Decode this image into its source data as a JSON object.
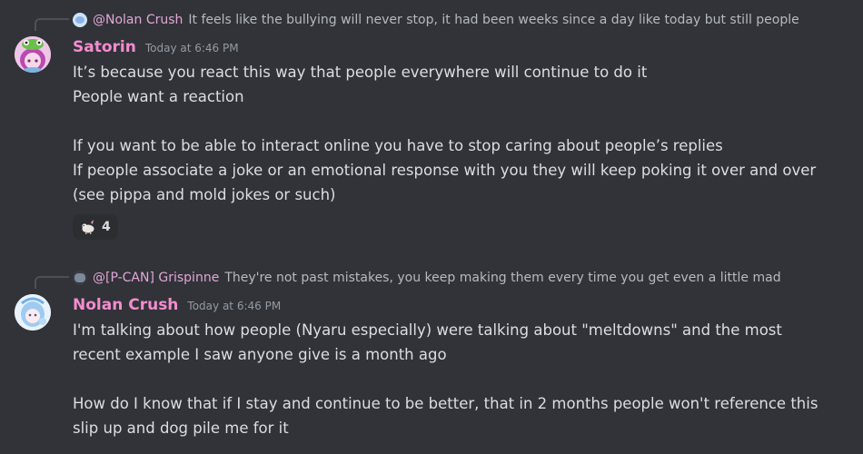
{
  "messages": [
    {
      "reply": {
        "author": "@Nolan Crush",
        "author_color": "#e2a7d6",
        "text": "It feels like the bullying will never stop, it had been weeks since a day like today but still people"
      },
      "author": "Satorin",
      "author_color": "#f48ccf",
      "timestamp": "Today at 6:46 PM",
      "lines": [
        "It’s because you react this way that people everywhere will continue to do it",
        "People want a reaction",
        "",
        "If you want to be able to interact online you have to stop caring about people’s replies",
        "If people associate a joke or an emotional response with you they will keep poking it over and over",
        "(see pippa and mold jokes or such)"
      ],
      "reaction": {
        "emoji": "sheep-emoji",
        "count": "4"
      }
    },
    {
      "reply": {
        "author": "@[P-CAN] Grispinne",
        "author_color": "#e2a7d6",
        "text": "They're not past mistakes, you keep making them every time you get even a little mad"
      },
      "author": "Nolan Crush",
      "author_color": "#f48ccf",
      "timestamp": "Today at 6:46 PM",
      "lines": [
        "I'm talking about how people (Nyaru especially) were talking about \"meltdowns\" and the most",
        "recent example I saw anyone give is a month ago",
        "",
        "How do I know that if I stay and continue to be better, that in 2 months people won't reference this",
        "slip up and dog pile me for it"
      ]
    }
  ],
  "colors": {
    "background": "#313338",
    "text": "#dbdee1",
    "muted": "#949ba4"
  }
}
